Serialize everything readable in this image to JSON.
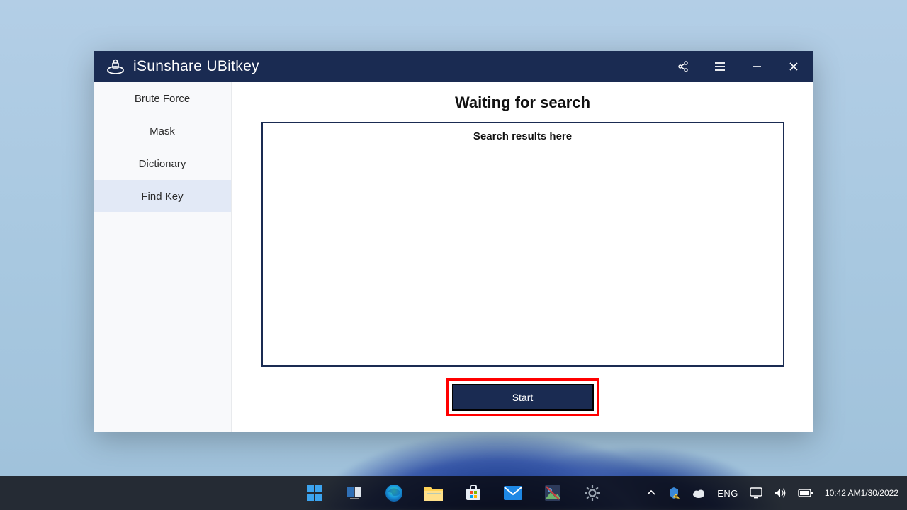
{
  "app": {
    "title": "iSunshare UBitkey",
    "logo_name": "lock-drive-icon"
  },
  "titlebar": {
    "share_name": "share-icon",
    "menu_name": "menu-icon",
    "minimize_name": "minimize-icon",
    "close_name": "close-icon"
  },
  "sidebar": {
    "items": [
      {
        "label": "Brute Force",
        "name": "nav-brute-force",
        "active": false
      },
      {
        "label": "Mask",
        "name": "nav-mask",
        "active": false
      },
      {
        "label": "Dictionary",
        "name": "nav-dictionary",
        "active": false
      },
      {
        "label": "Find Key",
        "name": "nav-find-key",
        "active": true
      }
    ]
  },
  "main": {
    "heading": "Waiting for search",
    "results_placeholder": "Search results here",
    "start_label": "Start"
  },
  "taskbar": {
    "apps": [
      {
        "name": "start-menu-icon"
      },
      {
        "name": "task-view-icon"
      },
      {
        "name": "edge-browser-icon"
      },
      {
        "name": "file-explorer-icon"
      },
      {
        "name": "microsoft-store-icon"
      },
      {
        "name": "mail-app-icon"
      },
      {
        "name": "photos-app-icon"
      },
      {
        "name": "settings-app-icon"
      }
    ],
    "tray": {
      "chevron_name": "tray-overflow-icon",
      "security_name": "security-warning-icon",
      "weather_name": "weather-cloud-icon",
      "language": "ENG",
      "pc_name": "cast-display-icon",
      "volume_name": "volume-icon",
      "battery_name": "battery-icon",
      "time": "10:42 AM",
      "date": "1/30/2022"
    }
  },
  "colors": {
    "titlebar_bg": "#1a2b52",
    "highlight_border": "#ff0000",
    "sidebar_active_bg": "#e2e9f6"
  }
}
